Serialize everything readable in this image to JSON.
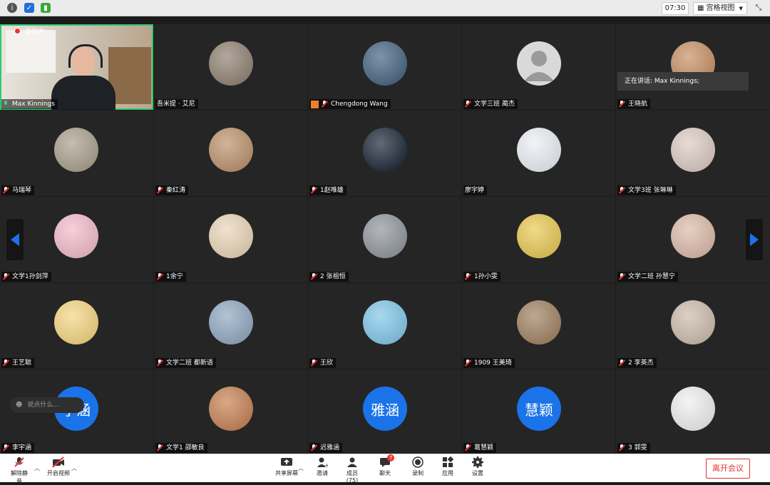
{
  "topbar": {
    "clock": "07:30",
    "view_label": "宫格视图",
    "colors": {
      "info": "#555555",
      "shield": "#1e6fd9",
      "signal": "#3aa83a"
    }
  },
  "recording_label": "录制中",
  "speaking_label": "正在讲话: Max Kinnings;",
  "chat_placeholder": "说点什么...",
  "tiles": [
    {
      "name": "Max Kinnings",
      "kind": "video",
      "mic": "on"
    },
    {
      "name": "吾米提 · 艾尼",
      "kind": "photo",
      "color": "#8a7a6a",
      "mic": "none"
    },
    {
      "name": "Chengdong Wang",
      "kind": "photo",
      "color": "#3b5a7a",
      "mic": "muted",
      "badge": "user-icon"
    },
    {
      "name": "文学三班 蔺杰",
      "kind": "default",
      "color": "#d9d9d9",
      "mic": "muted"
    },
    {
      "name": "王晓航",
      "kind": "photo",
      "color": "#c48a5c",
      "mic": "muted"
    },
    {
      "name": "马瑞琴",
      "kind": "photo",
      "color": "#a59a86",
      "mic": "muted"
    },
    {
      "name": "秦红涛",
      "kind": "photo",
      "color": "#b98c63",
      "mic": "muted"
    },
    {
      "name": "1赵唯雄",
      "kind": "photo",
      "color": "#0d1a2a",
      "mic": "muted"
    },
    {
      "name": "廖宇婷",
      "kind": "photo",
      "color": "#e9eef3",
      "mic": "none"
    },
    {
      "name": "文学3班 张琳琳",
      "kind": "photo",
      "color": "#d9c8c0",
      "mic": "muted"
    },
    {
      "name": "文学1孙剑萍",
      "kind": "photo",
      "color": "#f1b8c8",
      "mic": "muted"
    },
    {
      "name": "1余宁",
      "kind": "photo",
      "color": "#e8d3b5",
      "mic": "muted"
    },
    {
      "name": "2 张祖恒",
      "kind": "photo",
      "color": "#8a9098",
      "mic": "muted"
    },
    {
      "name": "1孙小雯",
      "kind": "photo",
      "color": "#e8c64a",
      "mic": "muted"
    },
    {
      "name": "文学二班 孙慧宁",
      "kind": "photo",
      "color": "#d9b7a4",
      "mic": "muted"
    },
    {
      "name": "王艺聪",
      "kind": "photo",
      "color": "#f4d37a",
      "mic": "muted"
    },
    {
      "name": "文学二班 都新语",
      "kind": "photo",
      "color": "#8aa3bd",
      "mic": "muted"
    },
    {
      "name": "王欣",
      "kind": "photo",
      "color": "#7ac4e8",
      "mic": "muted"
    },
    {
      "name": "1909 王美琦",
      "kind": "photo",
      "color": "#9b7a58",
      "mic": "muted"
    },
    {
      "name": "2 李英杰",
      "kind": "photo",
      "color": "#c9b8a8",
      "mic": "muted"
    },
    {
      "name": "李宇涵",
      "kind": "text",
      "text": "宇涵",
      "color": "#1a73e8",
      "mic": "muted"
    },
    {
      "name": "文学1 邵敏良",
      "kind": "photo",
      "color": "#c47a4a",
      "mic": "muted"
    },
    {
      "name": "迟雅涵",
      "kind": "text",
      "text": "雅涵",
      "color": "#1a73e8",
      "mic": "muted"
    },
    {
      "name": "葛慧颖",
      "kind": "text",
      "text": "慧颖",
      "color": "#1a73e8",
      "mic": "muted"
    },
    {
      "name": "3 郭雯",
      "kind": "photo",
      "color": "#eeeeee",
      "mic": "muted"
    }
  ],
  "bottombar": {
    "unmute_label": "解除静音",
    "video_label": "开启视频",
    "share_label": "共享屏幕",
    "invite_label": "邀请",
    "members_label": "成员(75)",
    "chat_label": "聊天",
    "chat_badge": "7",
    "record_label": "录制",
    "apps_label": "应用",
    "settings_label": "设置",
    "leave_label": "离开会议"
  }
}
